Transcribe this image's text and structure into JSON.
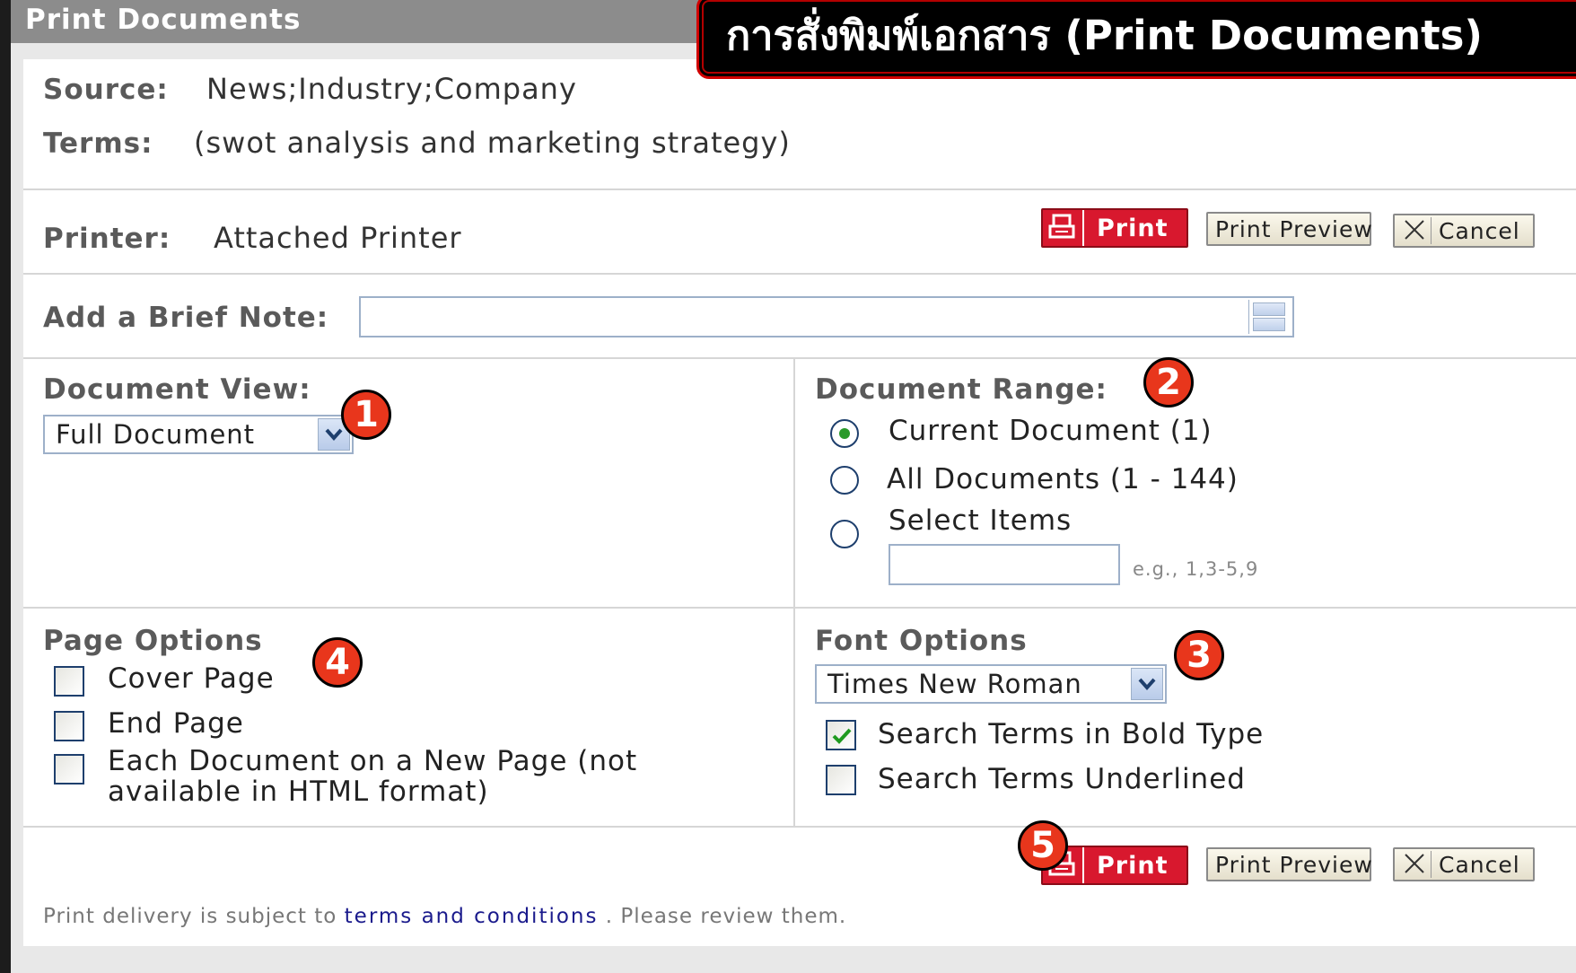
{
  "window": {
    "title": "Print Documents"
  },
  "banner": {
    "text": "การสั่งพิมพ์เอกสาร (Print Documents)"
  },
  "source": {
    "label": "Source:",
    "value": "News;Industry;Company"
  },
  "terms": {
    "label": "Terms:",
    "value": "(swot analysis and marketing strategy)"
  },
  "printer": {
    "label": "Printer:",
    "value": "Attached Printer"
  },
  "buttons": {
    "print": "Print",
    "preview": "Print Preview",
    "cancel": "Cancel"
  },
  "note": {
    "label": "Add a Brief Note:",
    "value": ""
  },
  "document_view": {
    "label": "Document View:",
    "selected": "Full Document"
  },
  "document_range": {
    "label": "Document Range:",
    "options": [
      "Current Document (1)",
      "All Documents (1 - 144)",
      "Select Items"
    ],
    "selected_index": 0,
    "select_items_value": "",
    "hint": "e.g., 1,3-5,9"
  },
  "page_options": {
    "label": "Page Options",
    "items": [
      {
        "label": "Cover Page",
        "checked": false
      },
      {
        "label": "End Page",
        "checked": false
      },
      {
        "label": "Each Document on a New Page (not",
        "label_line2": "available in HTML format)",
        "checked": false
      }
    ]
  },
  "font_options": {
    "label": "Font Options",
    "selected": "Times New Roman",
    "items": [
      {
        "label": "Search Terms in Bold Type",
        "checked": true
      },
      {
        "label": "Search Terms Underlined",
        "checked": false
      }
    ]
  },
  "footer": {
    "prefix": "Print delivery is subject to",
    "link": "terms and conditions",
    "suffix": ". Please review them."
  },
  "callouts": [
    "1",
    "2",
    "3",
    "4",
    "5"
  ],
  "colors": {
    "print_button": "#d8182e",
    "callout": "#e8361c",
    "banner_border": "#d10000"
  }
}
